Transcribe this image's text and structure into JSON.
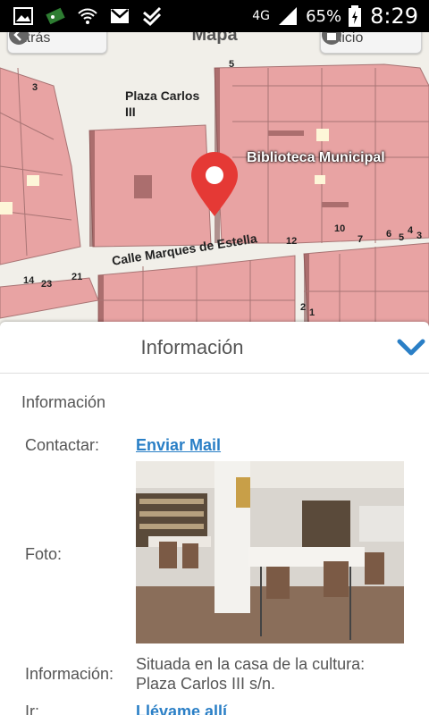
{
  "status_bar": {
    "network": "4G",
    "battery": "65%",
    "time": "8:29",
    "icons": [
      "gallery-icon",
      "game-icon",
      "wifi-icon",
      "gmail-icon",
      "check-icon",
      "signal-icon",
      "battery-icon"
    ]
  },
  "map": {
    "title": "Mapa",
    "back_button": "Atrás",
    "home_button": "Inicio",
    "labels": {
      "plaza": "Plaza Carlos\nIII",
      "biblioteca": "Biblioteca Municipal",
      "calle": "Calle Marques de Estella"
    },
    "numbers": [
      "3",
      "5",
      "12",
      "10",
      "7",
      "6",
      "5",
      "4",
      "3",
      "14",
      "23",
      "21",
      "2",
      "1"
    ]
  },
  "panel": {
    "title": "Información",
    "section": "Información",
    "rows": {
      "contact_label": "Contactar:",
      "contact_link": "Enviar Mail",
      "photo_label": "Foto:",
      "info_label": "Información:",
      "info_text": "Situada en la casa de la cultura:\nPlaza Carlos III s/n.",
      "go_label": "Ir:",
      "go_link": "Llévame allí"
    }
  },
  "colors": {
    "accent": "#2a7fc6",
    "building": "#e8a3a3",
    "marker": "#e53935"
  }
}
